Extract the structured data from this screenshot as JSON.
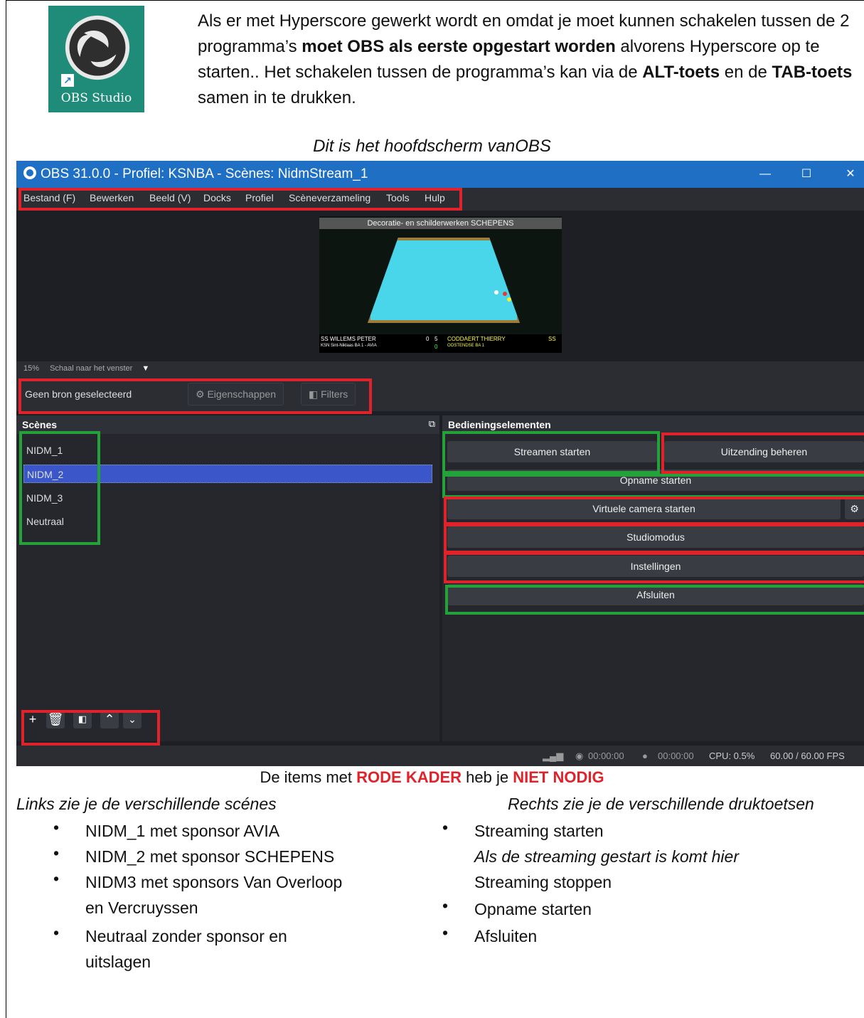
{
  "header": {
    "tile_label": "OBS Studio",
    "intro_parts": [
      "Als er met Hyperscore gewerkt wordt en omdat je moet kunnen schakelen tussen de 2 programma’s ",
      "moet OBS als eerste opgestart worden",
      " alvorens Hyperscore op te starten.. Het schakelen tussen de programma’s kan via de ",
      "ALT-toets",
      " en de ",
      "TAB-toets",
      " samen in te drukken."
    ],
    "caption": "Dit is het hoofdscherm vanOBS"
  },
  "window": {
    "title": "OBS 31.0.0 - Profiel: KSNBA - Scènes: NidmStream_1",
    "controls": {
      "minimize": "—",
      "maximize": "☐",
      "close": "✕"
    },
    "menu": [
      "Bestand (F)",
      "Bewerken",
      "Beeld (V)",
      "Docks",
      "Profiel",
      "Scèneverzameling",
      "Tools",
      "Hulp"
    ],
    "preview": {
      "banner": "Decoratie- en schilderwerken SCHEPENS",
      "player_left": "SS WILLEMS PETER",
      "club_left": "KSN Sint-Niklaas BA 1 - AVIA",
      "score_left": "0",
      "score_mid": "5",
      "score_green": "0",
      "player_right": "CODDAERT THIERRY",
      "club_right": "OOSTENDSE BA 1",
      "code_right": "SS"
    },
    "zoom": {
      "percent": "15%",
      "label": "Schaal naar het venster"
    },
    "source_bar": {
      "label": "Geen bron geselecteerd",
      "properties": "Eigenschappen",
      "filters": "Filters"
    },
    "scenes": {
      "title": "Scènes",
      "items": [
        "NIDM_1",
        "NIDM_2",
        "NIDM_3",
        "Neutraal"
      ],
      "selected": "NIDM_2"
    },
    "controls_panel": {
      "title": "Bedieningselementen",
      "stream": "Streamen starten",
      "broadcast": "Uitzending beheren",
      "record": "Opname starten",
      "virtual_cam": "Virtuele camera starten",
      "studio": "Studiomodus",
      "settings": "Instellingen",
      "exit": "Afsluiten"
    },
    "status": {
      "stream_time": "00:00:00",
      "rec_time": "00:00:00",
      "cpu": "CPU: 0.5%",
      "fps": "60.00 / 60.00 FPS"
    }
  },
  "notes": {
    "red_parts": [
      "De items met ",
      "RODE KADER",
      " heb je ",
      "NIET NODIG"
    ],
    "left_head": "Links zie je de verschillende scénes",
    "right_head": "Rechts zie je de verschillende druktoetsen",
    "left_list": [
      "NIDM_1 met sponsor AVIA",
      "NIDM_2 met sponsor SCHEPENS",
      "NIDM3 met sponsors Van Overloop",
      "en Vercruyssen",
      "Neutraal zonder sponsor en",
      "uitslagen"
    ],
    "right_list": [
      "Streaming starten",
      "Als de streaming gestart is  komt hier",
      "Streaming stoppen",
      "Opname starten",
      "Afsluiten"
    ],
    "bullet": "•"
  },
  "colors": {
    "highlight_red": "#e0222a",
    "highlight_green": "#24a23a",
    "title_blue": "#1f6fc5",
    "obs_tile": "#1f8c7a"
  }
}
